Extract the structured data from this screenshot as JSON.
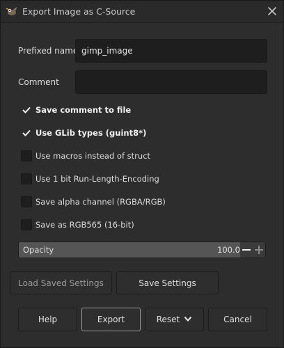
{
  "window": {
    "title": "Export Image as C-Source",
    "app_icon": "gimp-wilber-icon",
    "close_icon": "close-icon"
  },
  "fields": {
    "prefixed_name": {
      "label": "Prefixed name",
      "value": "gimp_image",
      "placeholder": ""
    },
    "comment": {
      "label": "Comment",
      "value": "",
      "placeholder": ""
    }
  },
  "options": [
    {
      "label": "Save comment to file",
      "checked": true
    },
    {
      "label": "Use GLib types (guint8*)",
      "checked": true
    },
    {
      "label": "Use macros instead of struct",
      "checked": false
    },
    {
      "label": "Use 1 bit Run-Length-Encoding",
      "checked": false
    },
    {
      "label": "Save alpha channel (RGBA/RGB)",
      "checked": false
    },
    {
      "label": "Save as RGB565 (16-bit)",
      "checked": false
    }
  ],
  "opacity": {
    "label": "Opacity",
    "value": "100.0",
    "fraction": 1.0,
    "decrement_icon": "minus-icon",
    "increment_icon": "plus-icon"
  },
  "settings_buttons": {
    "load": "Load Saved Settings",
    "save": "Save Settings"
  },
  "action_buttons": {
    "help": "Help",
    "export": "Export",
    "reset": "Reset",
    "reset_icon": "chevron-down-icon",
    "cancel": "Cancel"
  },
  "colors": {
    "background": "#2d2d2d",
    "input_background": "#1e1e1e",
    "text": "#dcdcdc",
    "default_button_border": "#9a9a9a"
  }
}
